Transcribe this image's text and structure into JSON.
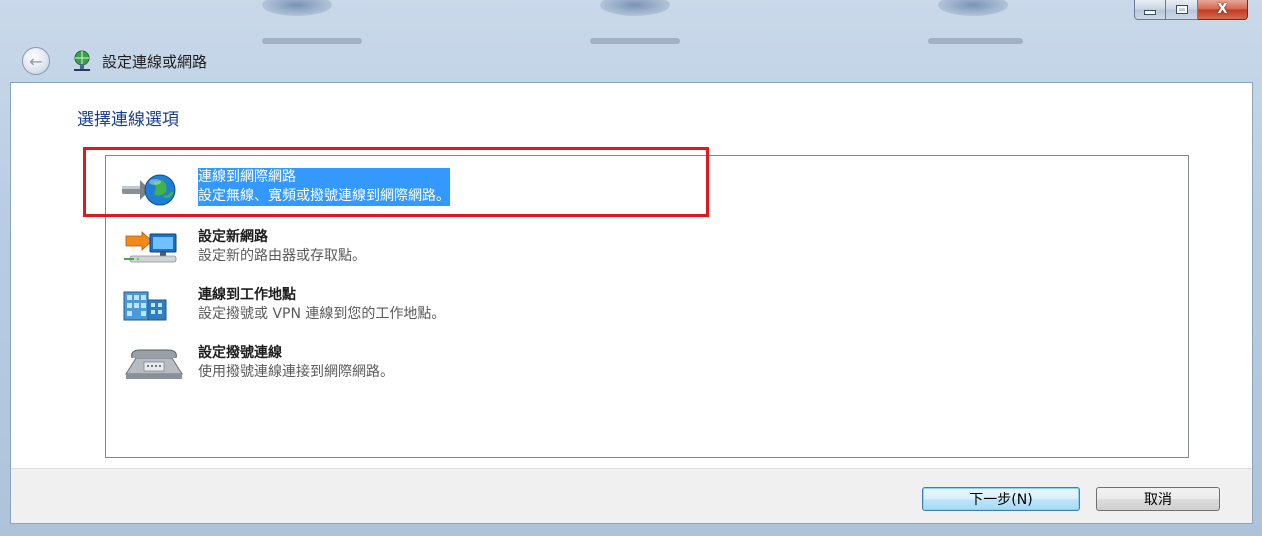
{
  "window": {
    "title": "設定連線或網路",
    "caption": {
      "minimize": "minimize",
      "maximize": "maximize",
      "close": "X"
    }
  },
  "main": {
    "heading": "選擇連線選項",
    "options": [
      {
        "title": "連線到網際網路",
        "description": "設定無線、寬頻或撥號連線到網際網路。",
        "icon": "globe-connect-icon",
        "selected": true
      },
      {
        "title": "設定新網路",
        "description": "設定新的路由器或存取點。",
        "icon": "new-network-router-icon",
        "selected": false
      },
      {
        "title": "連線到工作地點",
        "description": "設定撥號或 VPN 連線到您的工作地點。",
        "icon": "workplace-building-icon",
        "selected": false
      },
      {
        "title": "設定撥號連線",
        "description": "使用撥號連線連接到網際網路。",
        "icon": "dialup-phone-icon",
        "selected": false
      }
    ]
  },
  "footer": {
    "next_label": "下一步(N)",
    "cancel_label": "取消"
  },
  "colors": {
    "selection": "#3399ff",
    "heading": "#1a3e8a",
    "highlight_box": "#e0191c"
  }
}
